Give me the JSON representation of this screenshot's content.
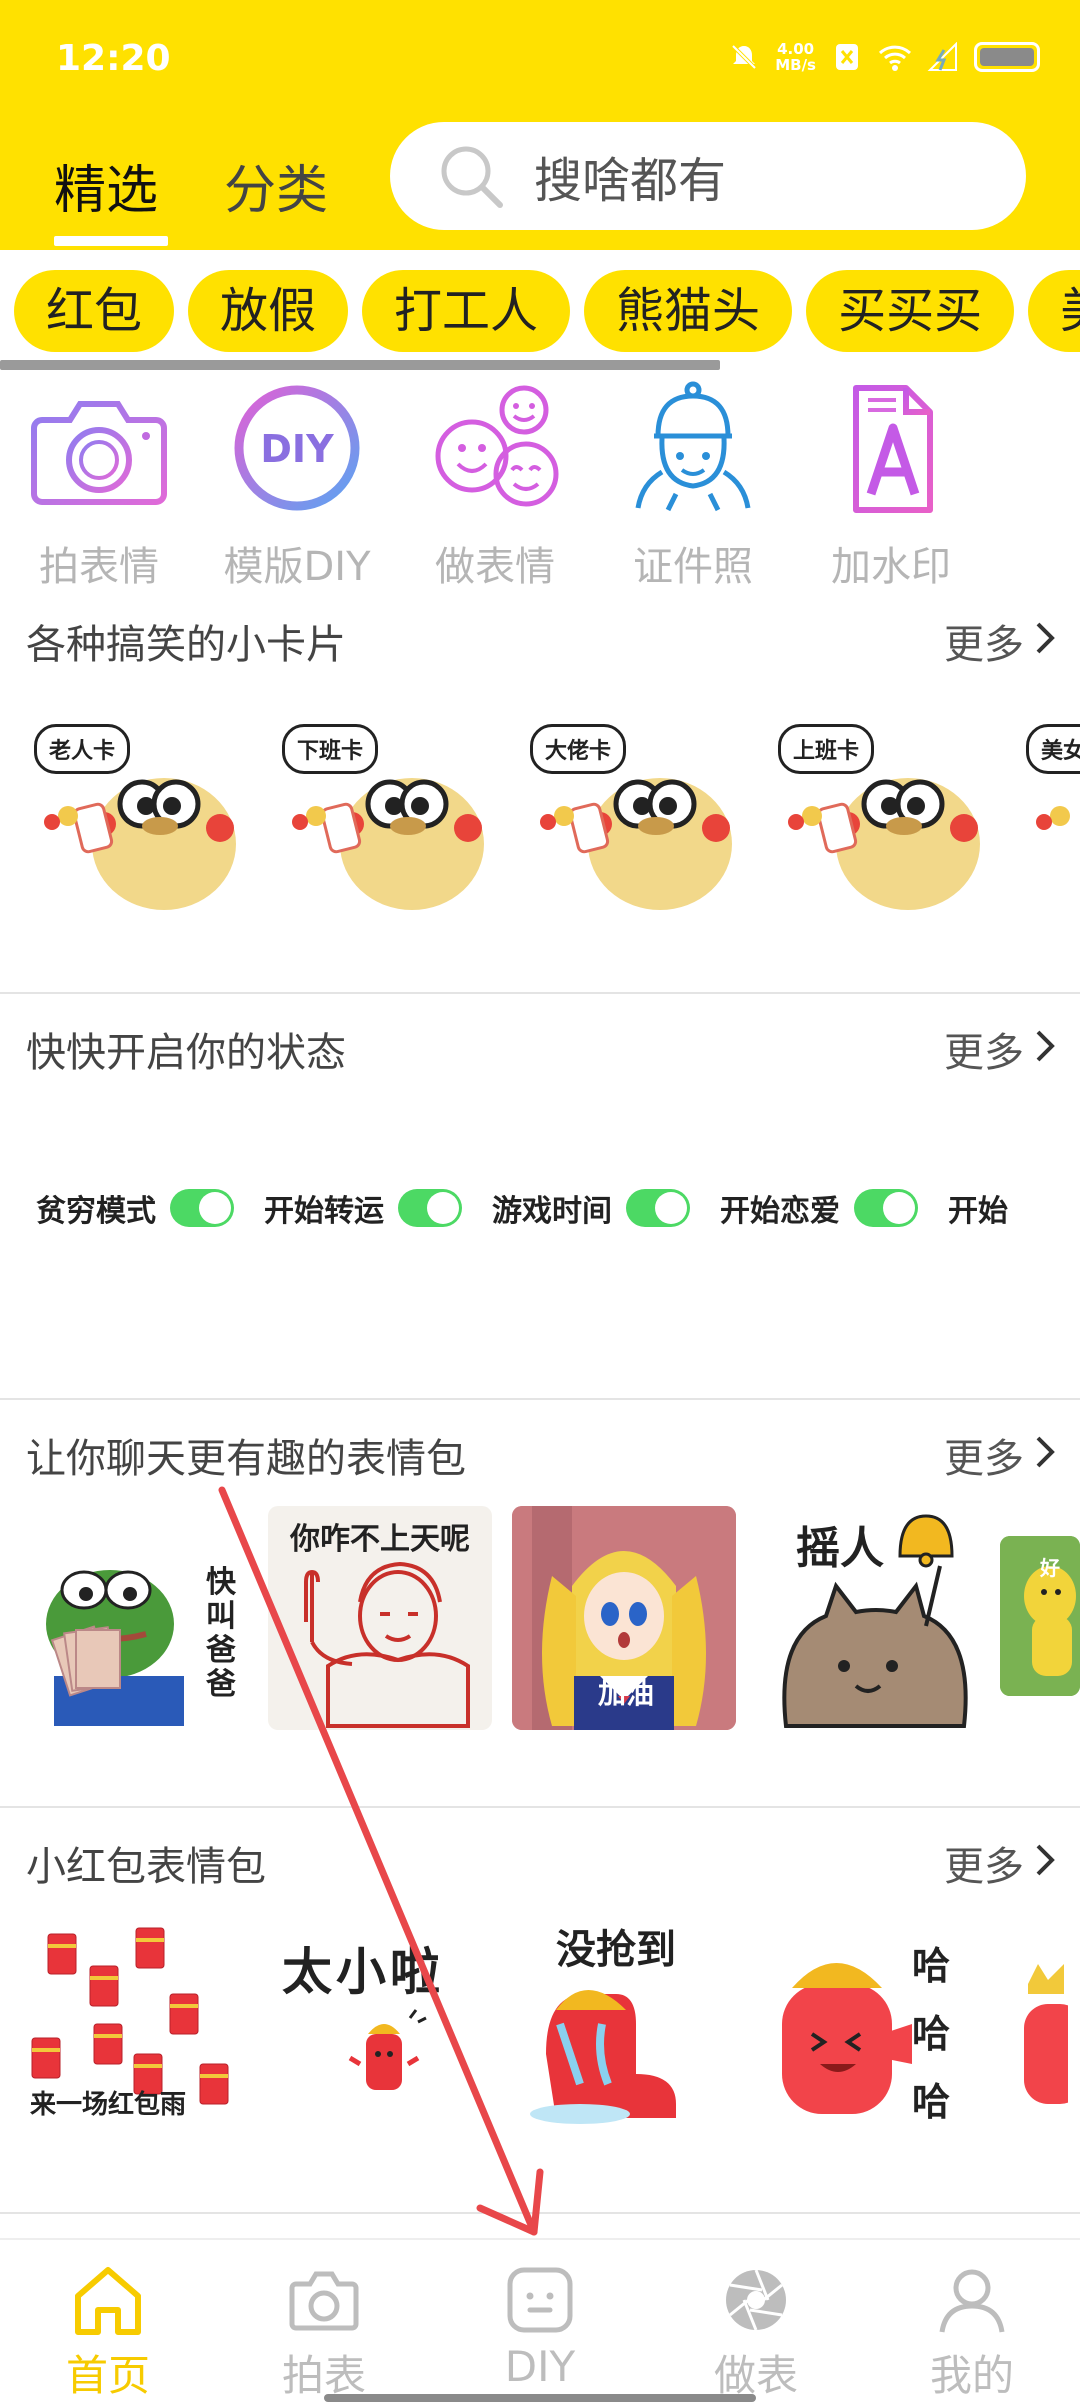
{
  "status_bar": {
    "time": "12:20",
    "net_speed_value": "4.00",
    "net_speed_unit": "MB/s"
  },
  "header": {
    "tabs": [
      {
        "label": "精选",
        "active": true
      },
      {
        "label": "分类",
        "active": false
      }
    ],
    "search_placeholder": "搜啥都有"
  },
  "chips": [
    "红包",
    "放假",
    "打工人",
    "熊猫头",
    "买买买",
    "美"
  ],
  "tools": [
    {
      "label": "拍表情",
      "icon": "camera-icon"
    },
    {
      "label": "模版DIY",
      "icon": "diy-circle-icon"
    },
    {
      "label": "做表情",
      "icon": "smiley-faces-icon"
    },
    {
      "label": "证件照",
      "icon": "id-photo-person-icon"
    },
    {
      "label": "加水印",
      "icon": "watermark-document-icon"
    }
  ],
  "more_label": "更多",
  "sections": {
    "cards": {
      "title": "各种搞笑的小卡片",
      "items": [
        "老人卡",
        "下班卡",
        "大佬卡",
        "上班卡",
        "美女卡"
      ]
    },
    "status": {
      "title": "快快开启你的状态",
      "items": [
        "贫穷模式",
        "开始转运",
        "游戏时间",
        "开始恋爱",
        "开始"
      ]
    },
    "memes": {
      "title": "让你聊天更有趣的表情包",
      "items": [
        {
          "caption": "快叫爸爸"
        },
        {
          "caption": "你咋不上天呢"
        },
        {
          "caption": "加油"
        },
        {
          "caption": "摇人"
        },
        {
          "caption": "好"
        }
      ]
    },
    "red_packets": {
      "title": "小红包表情包",
      "items": [
        {
          "caption": "来一场红包雨"
        },
        {
          "caption": "太小啦"
        },
        {
          "caption": "没抢到"
        },
        {
          "caption": "哈哈哈"
        }
      ]
    }
  },
  "bottom_nav": [
    {
      "label": "首页",
      "active": true,
      "icon": "home-icon"
    },
    {
      "label": "拍表",
      "active": false,
      "icon": "camera-icon"
    },
    {
      "label": "DIY",
      "active": false,
      "icon": "diy-face-icon"
    },
    {
      "label": "做表",
      "active": false,
      "icon": "aperture-icon"
    },
    {
      "label": "我的",
      "active": false,
      "icon": "user-icon"
    }
  ],
  "colors": {
    "brand_yellow": "#FFE100",
    "active_nav": "#F7CB00",
    "toggle_green": "#4CD964",
    "annotation_red": "#E8474A"
  }
}
